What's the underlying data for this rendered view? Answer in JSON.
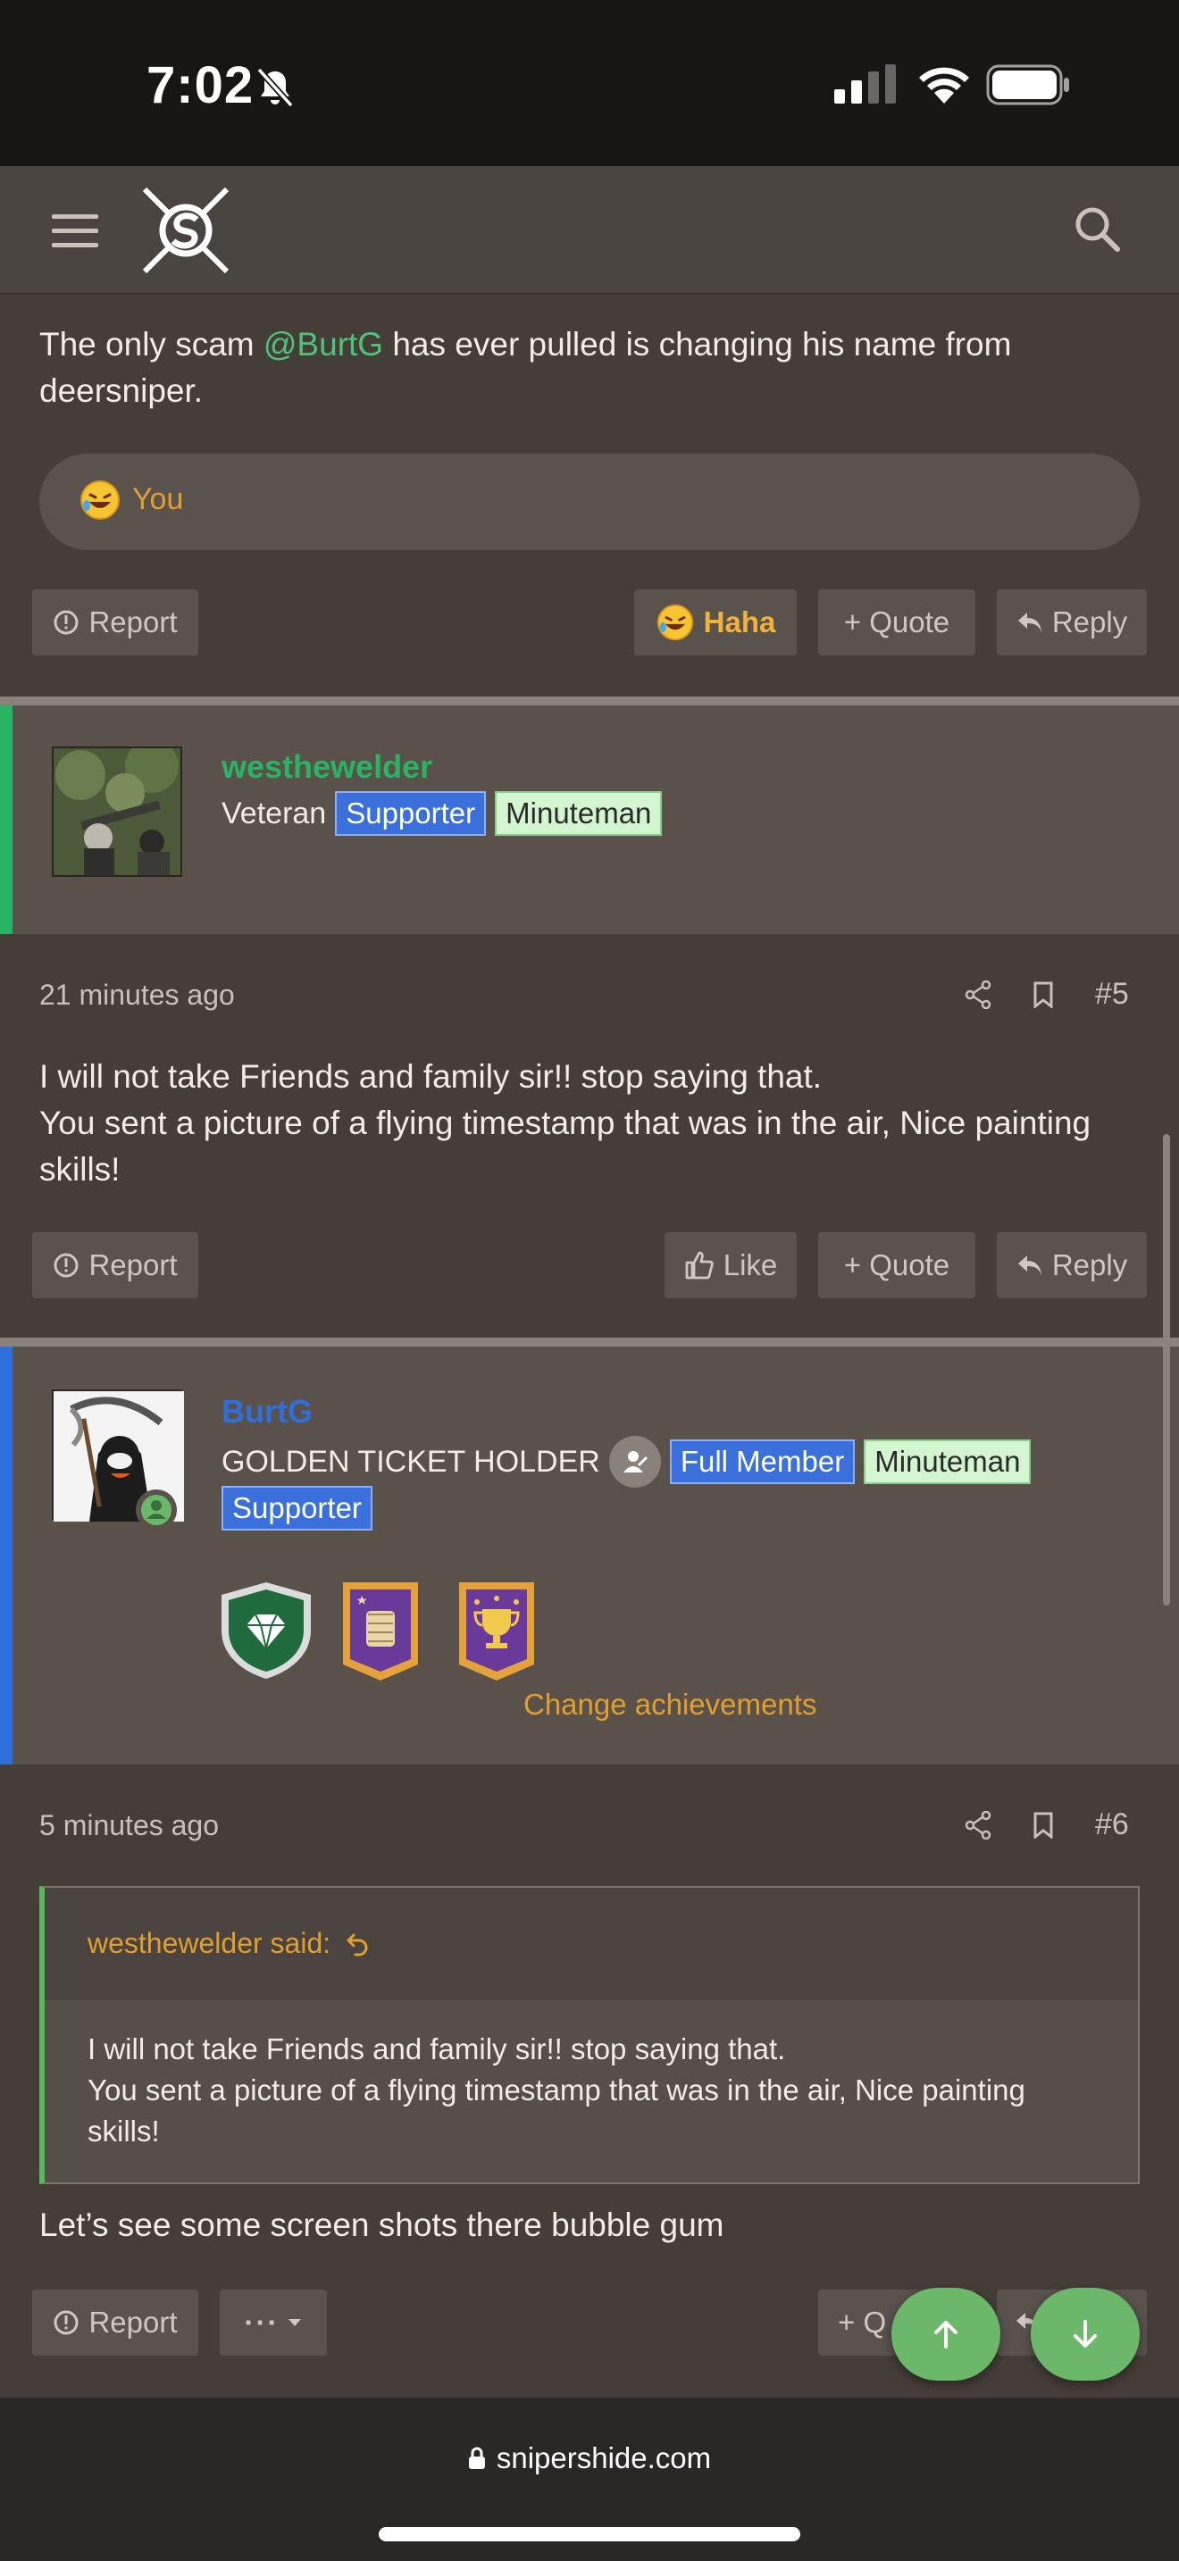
{
  "status_bar": {
    "time": "7:02"
  },
  "post4": {
    "text_before": "The only scam ",
    "mention": "@BurtG",
    "text_after": " has ever pulled is changing his name from deersniper.",
    "reaction_summary": "You",
    "actions": {
      "report": "Report",
      "reaction": "Haha",
      "quote": "+ Quote",
      "reply": "Reply"
    }
  },
  "post5": {
    "username": "westhewelder",
    "title": "Veteran",
    "badges": [
      "Supporter",
      "Minuteman"
    ],
    "time": "21 minutes ago",
    "number": "#5",
    "text_line1": "I will not take Friends and family sir!! stop saying that.",
    "text_line2": "You sent a picture of a flying timestamp that was in the air, Nice painting skills!",
    "actions": {
      "report": "Report",
      "like": "Like",
      "quote": "+ Quote",
      "reply": "Reply"
    }
  },
  "post6": {
    "username": "BurtG",
    "title": "GOLDEN TICKET HOLDER",
    "badges": [
      "Full Member",
      "Minuteman",
      "Supporter"
    ],
    "change_achievements": "Change achievements",
    "time": "5 minutes ago",
    "number": "#6",
    "quote_author": "westhewelder said:",
    "quote_line1": "I will not take Friends and family sir!! stop saying that.",
    "quote_line2": "You sent a picture of a flying timestamp that was in the air, Nice painting skills!",
    "text": "Let’s see some screen shots there bubble gum",
    "actions": {
      "report": "Report",
      "more": "···",
      "quote": "+ Q"
    }
  },
  "browser": {
    "url": "snipershide.com"
  },
  "colors": {
    "accent_orange": "#e0a030",
    "mention_green": "#4fc37a",
    "supporter_blue": "#3a6fdc",
    "fab_green": "#6bb86b"
  }
}
